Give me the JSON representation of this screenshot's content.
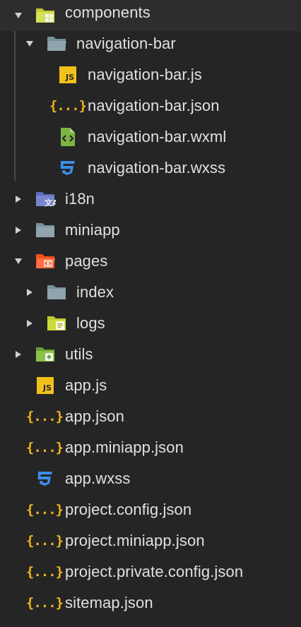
{
  "explorer": {
    "items": [
      {
        "label": "components",
        "icon": "components-folder-icon",
        "expanded": true
      },
      {
        "label": "navigation-bar",
        "icon": "folder-open-icon",
        "expanded": true
      },
      {
        "label": "navigation-bar.js",
        "icon": "js-file-icon"
      },
      {
        "label": "navigation-bar.json",
        "icon": "json-file-icon"
      },
      {
        "label": "navigation-bar.wxml",
        "icon": "wxml-file-icon"
      },
      {
        "label": "navigation-bar.wxss",
        "icon": "wxss-file-icon"
      },
      {
        "label": "i18n",
        "icon": "i18n-folder-icon",
        "expanded": false
      },
      {
        "label": "miniapp",
        "icon": "folder-icon",
        "expanded": false
      },
      {
        "label": "pages",
        "icon": "pages-folder-icon",
        "expanded": true
      },
      {
        "label": "index",
        "icon": "folder-icon",
        "expanded": false
      },
      {
        "label": "logs",
        "icon": "logs-folder-icon",
        "expanded": false
      },
      {
        "label": "utils",
        "icon": "utils-folder-icon",
        "expanded": false
      },
      {
        "label": "app.js",
        "icon": "js-file-icon"
      },
      {
        "label": "app.json",
        "icon": "json-file-icon"
      },
      {
        "label": "app.miniapp.json",
        "icon": "json-file-icon"
      },
      {
        "label": "app.wxss",
        "icon": "wxss-file-icon"
      },
      {
        "label": "project.config.json",
        "icon": "json-file-icon"
      },
      {
        "label": "project.miniapp.json",
        "icon": "json-file-icon"
      },
      {
        "label": "project.private.config.json",
        "icon": "json-file-icon"
      },
      {
        "label": "sitemap.json",
        "icon": "json-file-icon"
      }
    ],
    "badges": {
      "js": "JS",
      "json": "{...}"
    }
  },
  "colors": {
    "background": "#252526",
    "selected_row": "#2d2d2d",
    "text": "#e0e0e0",
    "js_yellow": "#f0c11b",
    "json_yellow": "#f0b51b",
    "wxss_blue": "#3b8eea",
    "wxml_green": "#7cb342",
    "folder_gray": "#90a4ae",
    "components_green": "#c0ca33",
    "i18n_indigo": "#5c6bc0",
    "pages_orange": "#ff7043"
  }
}
